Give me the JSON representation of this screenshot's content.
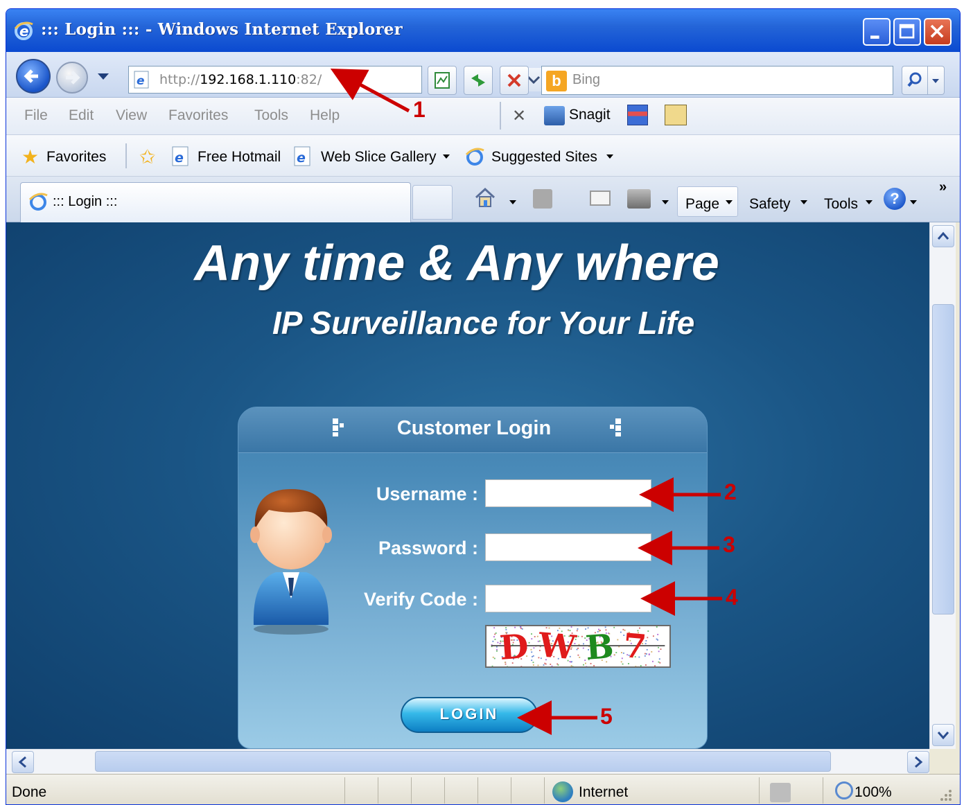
{
  "window": {
    "title": "::: Login ::: - Windows Internet Explorer"
  },
  "address_bar": {
    "url_prefix": "http://",
    "url_host": "192.168.1.110",
    "url_port": ":82/",
    "search_placeholder": "Bing"
  },
  "menu": {
    "items": [
      "File",
      "Edit",
      "View",
      "Favorites",
      "Tools",
      "Help"
    ],
    "snagit_label": "Snagit"
  },
  "favorites_bar": {
    "favorites_label": "Favorites",
    "links": [
      "Free Hotmail",
      "Web Slice Gallery",
      "Suggested Sites"
    ]
  },
  "tab": {
    "title": "::: Login :::"
  },
  "command_bar": {
    "page": "Page",
    "safety": "Safety",
    "tools": "Tools",
    "help_glyph": "?",
    "more": "»"
  },
  "page": {
    "headline": "Any time & Any where",
    "subheadline": "IP Surveillance for Your Life",
    "login_box": {
      "title": "Customer Login",
      "username_label": "Username :",
      "password_label": "Password :",
      "verify_label": "Verify Code :",
      "captcha_chars": [
        "D",
        "W",
        "B",
        "7"
      ],
      "button_label": "LOGIN"
    }
  },
  "annotations": [
    "1",
    "2",
    "3",
    "4",
    "5"
  ],
  "status_bar": {
    "status": "Done",
    "zone": "Internet",
    "zoom": "100%"
  },
  "colors": {
    "title_bar": "#2465d8",
    "content_background": "#1a5585",
    "annotation_red": "#cc0000",
    "captcha_colors": [
      "#e01b1b",
      "#e01b1b",
      "#1e8a1e",
      "#e01b1b"
    ]
  },
  "icons": [
    "ie-logo-icon",
    "minimize-icon",
    "maximize-icon",
    "close-icon",
    "back-arrow-icon",
    "forward-arrow-icon",
    "compatibility-view-icon",
    "refresh-icon",
    "stop-icon",
    "bing-icon",
    "search-icon",
    "star-icon",
    "add-favorite-icon",
    "home-icon",
    "feeds-icon",
    "mail-icon",
    "print-icon",
    "help-icon",
    "globe-icon",
    "zoom-icon",
    "user-avatar-icon"
  ]
}
